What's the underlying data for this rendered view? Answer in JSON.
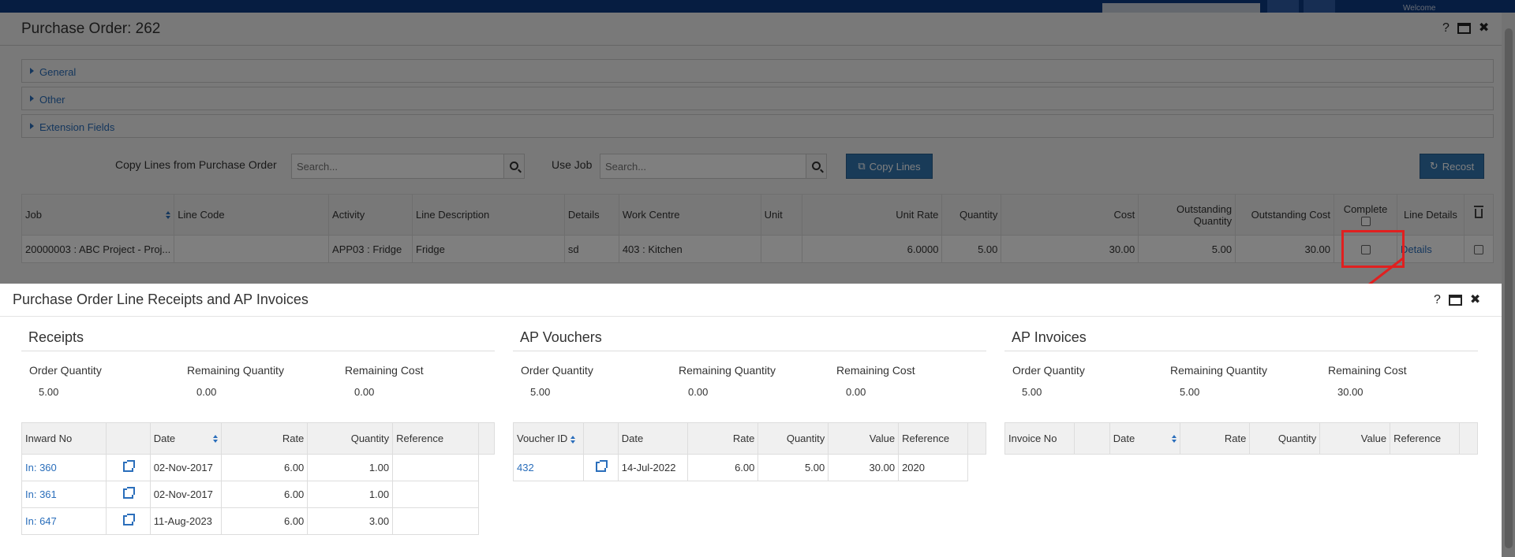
{
  "outer": {
    "title": "Purchase Order: 262",
    "panels": [
      "General",
      "Other",
      "Extension Fields"
    ],
    "copy_lines_label": "Copy Lines from Purchase Order",
    "copy_search_placeholder": "Search...",
    "use_job_label": "Use Job",
    "job_search_placeholder": "Search...",
    "copy_lines_button": "Copy Lines",
    "recost_button": "Recost",
    "welcome": "Welcome",
    "table": {
      "headers": {
        "job": "Job",
        "line_code": "Line Code",
        "activity": "Activity",
        "line_description": "Line Description",
        "details": "Details",
        "work_centre": "Work Centre",
        "unit": "Unit",
        "unit_rate": "Unit Rate",
        "quantity": "Quantity",
        "cost": "Cost",
        "outstanding_quantity": "Outstanding Quantity",
        "outstanding_cost": "Outstanding Cost",
        "complete": "Complete",
        "line_details": "Line Details"
      },
      "row": {
        "job": "20000003 : ABC Project - Proj...",
        "line_code": "",
        "activity": "APP03 : Fridge",
        "line_description": "Fridge",
        "details": "sd",
        "work_centre": "403 : Kitchen",
        "unit": "",
        "unit_rate": "6.0000",
        "quantity": "5.00",
        "cost": "30.00",
        "outstanding_quantity": "5.00",
        "outstanding_cost": "30.00",
        "line_details_link": "Details"
      }
    }
  },
  "inner": {
    "title": "Purchase Order Line Receipts and AP Invoices",
    "receipts": {
      "heading": "Receipts",
      "order_qty_label": "Order Quantity",
      "order_qty": "5.00",
      "remaining_qty_label": "Remaining Quantity",
      "remaining_qty": "0.00",
      "remaining_cost_label": "Remaining Cost",
      "remaining_cost": "0.00",
      "headers": {
        "inward_no": "Inward No",
        "date": "Date",
        "rate": "Rate",
        "quantity": "Quantity",
        "reference": "Reference"
      },
      "rows": [
        {
          "inward_no": "In: 360",
          "date": "02-Nov-2017",
          "rate": "6.00",
          "quantity": "1.00",
          "reference": ""
        },
        {
          "inward_no": "In: 361",
          "date": "02-Nov-2017",
          "rate": "6.00",
          "quantity": "1.00",
          "reference": ""
        },
        {
          "inward_no": "In: 647",
          "date": "11-Aug-2023",
          "rate": "6.00",
          "quantity": "3.00",
          "reference": ""
        }
      ]
    },
    "vouchers": {
      "heading": "AP Vouchers",
      "order_qty_label": "Order Quantity",
      "order_qty": "5.00",
      "remaining_qty_label": "Remaining Quantity",
      "remaining_qty": "0.00",
      "remaining_cost_label": "Remaining Cost",
      "remaining_cost": "0.00",
      "headers": {
        "voucher_id": "Voucher ID",
        "date": "Date",
        "rate": "Rate",
        "quantity": "Quantity",
        "value": "Value",
        "reference": "Reference"
      },
      "rows": [
        {
          "voucher_id": "432",
          "date": "14-Jul-2022",
          "rate": "6.00",
          "quantity": "5.00",
          "value": "30.00",
          "reference": "2020"
        }
      ]
    },
    "invoices": {
      "heading": "AP Invoices",
      "order_qty_label": "Order Quantity",
      "order_qty": "5.00",
      "remaining_qty_label": "Remaining Quantity",
      "remaining_qty": "5.00",
      "remaining_cost_label": "Remaining Cost",
      "remaining_cost": "30.00",
      "headers": {
        "invoice_no": "Invoice No",
        "date": "Date",
        "rate": "Rate",
        "quantity": "Quantity",
        "value": "Value",
        "reference": "Reference"
      }
    }
  },
  "colors": {
    "link": "#2a6ebb",
    "primary_button": "#3276b1",
    "highlight": "#e02020"
  }
}
